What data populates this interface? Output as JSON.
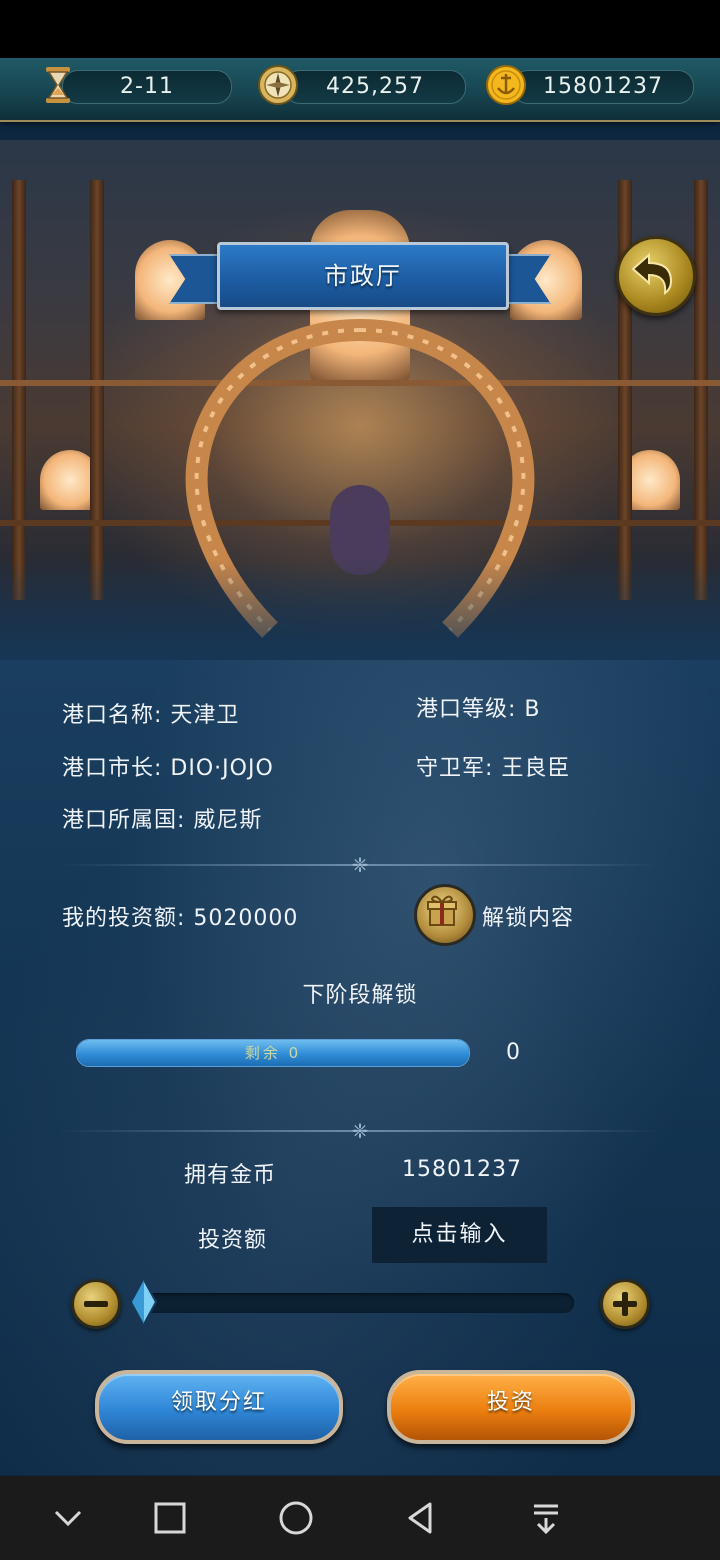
{
  "resources": {
    "stage": "2-11",
    "compass_value": "425,257",
    "gold_value": "15801237",
    "icons": {
      "stage": "hourglass-icon",
      "compass": "compass-icon",
      "gold": "anchor-coin-icon"
    }
  },
  "header": {
    "title": "市政厅",
    "back_icon": "back-arrow-icon"
  },
  "port_info": {
    "name_label": "港口名称:",
    "name_value": "天津卫",
    "level_label": "港口等级:",
    "level_value": "B",
    "mayor_label": "港口市长:",
    "mayor_value": "DIO·JOJO",
    "garrison_label": "守卫军:",
    "garrison_value": "王良臣",
    "nation_label": "港口所属国:",
    "nation_value": "威尼斯"
  },
  "investment": {
    "my_label": "我的投资额:",
    "my_value": "5020000",
    "unlock_label": "解锁内容",
    "next_stage_label": "下阶段解锁",
    "remaining_label": "剩余",
    "remaining_value": "0",
    "progress_fraction": 1.0,
    "progress_side_value": "0"
  },
  "funds": {
    "owned_label": "拥有金币",
    "owned_value": "15801237",
    "amount_label": "投资额",
    "amount_input_text": "点击输入",
    "slider_fraction": 0.0
  },
  "buttons": {
    "dividend": "领取分红",
    "invest": "投资"
  },
  "colors": {
    "accent_blue": "#2f86d6",
    "accent_orange": "#ec7f10",
    "gold": "#b08a3a"
  },
  "nav": {
    "icons": [
      "chevron-down-icon",
      "square-icon",
      "circle-icon",
      "triangle-back-icon",
      "download-icon"
    ]
  }
}
